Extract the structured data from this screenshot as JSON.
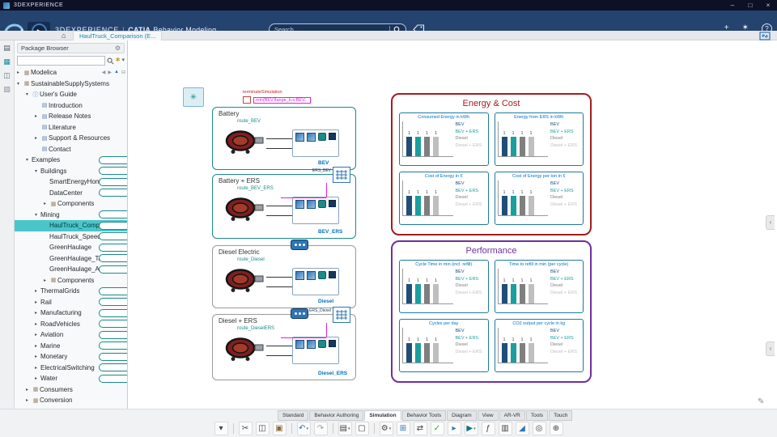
{
  "window": {
    "app_label": "3DEXPERIENCE",
    "minimize": "–",
    "maximize": "□",
    "close": "×"
  },
  "header": {
    "brand": "3DEXPERIENCE",
    "divider": "|",
    "app_bold": "CATIA",
    "app_name": "Behavior Modeling",
    "search_placeholder": "Search",
    "compass_text": "V.R",
    "right_icons": [
      {
        "name": "add-icon",
        "glyph": "+"
      },
      {
        "name": "tools-icon",
        "glyph": "✶"
      },
      {
        "name": "help-icon",
        "glyph": "?",
        "help": true
      }
    ]
  },
  "tabbar": {
    "home_glyph": "⌂",
    "tab_label": "HaulTruck_Comparison (E..."
  },
  "left_rail": [
    {
      "name": "content-panel-icon",
      "glyph": "▤",
      "color": "#4a5a68"
    },
    {
      "name": "search-panel-icon",
      "glyph": "▦",
      "color": "#1b8a9e"
    },
    {
      "name": "layers-panel-icon",
      "glyph": "◫",
      "color": "#6a7684"
    },
    {
      "name": "history-panel-icon",
      "glyph": "▧",
      "color": "#8a93a0"
    }
  ],
  "package_browser": {
    "title": "Package Browser",
    "gear_glyph": "⚙",
    "search_value": "",
    "nav_icons": [
      {
        "name": "back-icon",
        "glyph": "◀",
        "cls": ""
      },
      {
        "name": "forward-icon",
        "glyph": "▶",
        "cls": ""
      },
      {
        "name": "up-icon",
        "glyph": "▲",
        "cls": "up"
      },
      {
        "name": "collapse-all-icon",
        "glyph": "⊟",
        "cls": ""
      }
    ],
    "tree_icon_glyphs": {
      "package": "▦",
      "model": "▣",
      "info": "ⓘ",
      "doc": "▤"
    },
    "tree": [
      {
        "label": "Modelica",
        "level": 0,
        "icon": "package",
        "expander": "collapsed",
        "nav": true
      },
      {
        "label": "SustainableSupplySystems",
        "level": 0,
        "icon": "package",
        "expander": "expanded"
      },
      {
        "label": "User's Guide",
        "level": 1,
        "icon": "info",
        "expander": "expanded"
      },
      {
        "label": "Introduction",
        "level": 2,
        "icon": "doc"
      },
      {
        "label": "Release Notes",
        "level": 2,
        "icon": "doc",
        "expander": "collapsed"
      },
      {
        "label": "Literature",
        "level": 2,
        "icon": "doc"
      },
      {
        "label": "Support & Resources",
        "level": 2,
        "icon": "doc",
        "expander": "collapsed"
      },
      {
        "label": "Contact",
        "level": 2,
        "icon": "doc"
      },
      {
        "label": "Examples",
        "level": 1,
        "icon": "model",
        "expander": "expanded"
      },
      {
        "label": "Buildings",
        "level": 2,
        "icon": "model",
        "expander": "expanded"
      },
      {
        "label": "SmartEnergyHome",
        "level": 3,
        "icon": "model"
      },
      {
        "label": "DataCenter",
        "level": 3,
        "icon": "model"
      },
      {
        "label": "Components",
        "level": 3,
        "icon": "package",
        "expander": "collapsed"
      },
      {
        "label": "Mining",
        "level": 2,
        "icon": "model",
        "expander": "expanded"
      },
      {
        "label": "HaulTruck_Comparison",
        "level": 3,
        "icon": "model",
        "selected": true
      },
      {
        "label": "HaulTruck_SpeedERS",
        "level": 3,
        "icon": "model"
      },
      {
        "label": "GreenHaulage",
        "level": 3,
        "icon": "model"
      },
      {
        "label": "GreenHaulage_TableL...",
        "level": 3,
        "icon": "model"
      },
      {
        "label": "GreenHaulage_AvgdL...",
        "level": 3,
        "icon": "model"
      },
      {
        "label": "Components",
        "level": 3,
        "icon": "package",
        "expander": "collapsed"
      },
      {
        "label": "ThermalGrids",
        "level": 2,
        "icon": "model",
        "expander": "collapsed"
      },
      {
        "label": "Rail",
        "level": 2,
        "icon": "model",
        "expander": "collapsed"
      },
      {
        "label": "Manufacturing",
        "level": 2,
        "icon": "model",
        "expander": "collapsed"
      },
      {
        "label": "RoadVehicles",
        "level": 2,
        "icon": "model",
        "expander": "collapsed"
      },
      {
        "label": "Aviation",
        "level": 2,
        "icon": "model",
        "expander": "collapsed"
      },
      {
        "label": "Marine",
        "level": 2,
        "icon": "model",
        "expander": "collapsed"
      },
      {
        "label": "Monetary",
        "level": 2,
        "icon": "model",
        "expander": "collapsed"
      },
      {
        "label": "ElectricalSwitching",
        "level": 2,
        "icon": "model",
        "expander": "collapsed"
      },
      {
        "label": "Water",
        "level": 2,
        "icon": "model",
        "expander": "collapsed"
      },
      {
        "label": "Consumers",
        "level": 1,
        "icon": "package",
        "expander": "collapsed"
      },
      {
        "label": "Conversion",
        "level": 1,
        "icon": "package",
        "expander": "collapsed"
      }
    ]
  },
  "canvas": {
    "ambient": {
      "glyph": "✳"
    },
    "annotations": {
      "terminate_title": "terminateSimulation",
      "terminate_condition": "min(BEV.flange_b.s,BEV..."
    },
    "models": [
      {
        "title": "Battery",
        "route_label": "route_BEV",
        "result_label": "BEV",
        "accent": "#1b8a8a",
        "ers": false,
        "top_icon": false
      },
      {
        "title": "Battery + ERS",
        "route_label": "route_BEV_ERS",
        "result_label": "BEV_ERS",
        "accent": "#1b8a8a",
        "ers": true,
        "ers_label": "ERS_BEV",
        "top_icon": false
      },
      {
        "title": "Diesel Electric",
        "route_label": "route_Diesel",
        "result_label": "Diesel",
        "accent": "#9a9a9a",
        "ers": false,
        "top_icon": true
      },
      {
        "title": "Diesel + ERS",
        "route_label": "route_DieselERS",
        "result_label": "Diesel_ERS",
        "accent": "#9a9a9a",
        "ers": true,
        "ers_label": "ERS_Diesel",
        "top_icon": true
      }
    ],
    "groups": [
      {
        "title": "Energy & Cost",
        "color": "#a61c1c"
      },
      {
        "title": "Performance",
        "color": "#7030a0"
      }
    ]
  },
  "chart_data": [
    {
      "type": "bar",
      "group": "Energy & Cost",
      "title": "Consumed Energy in kWh",
      "categories": [
        "BEV",
        "BEV + ERS",
        "Diesel",
        "Diesel + ERS"
      ],
      "values": [
        1,
        1,
        1,
        1
      ],
      "bar_labels": [
        "1",
        "1",
        "1",
        "1"
      ],
      "colors": [
        "#1f4e79",
        "#1b9e9e",
        "#7f7f7f",
        "#bfbfbf"
      ],
      "legend_position": "right"
    },
    {
      "type": "bar",
      "group": "Energy & Cost",
      "title": "Energy from ERS in kWh",
      "categories": [
        "BEV",
        "BEV + ERS",
        "Diesel",
        "Diesel + ERS"
      ],
      "values": [
        1,
        1,
        1,
        1
      ],
      "bar_labels": [
        "1",
        "1",
        "1",
        "1"
      ],
      "colors": [
        "#1f4e79",
        "#1b9e9e",
        "#7f7f7f",
        "#bfbfbf"
      ],
      "legend_position": "right"
    },
    {
      "type": "bar",
      "group": "Energy & Cost",
      "title": "Cost of Energy in €",
      "categories": [
        "BEV",
        "BEV + ERS",
        "Diesel",
        "Diesel + ERS"
      ],
      "values": [
        1,
        1,
        1,
        1
      ],
      "bar_labels": [
        "1",
        "1",
        "1",
        "1"
      ],
      "colors": [
        "#1f4e79",
        "#1b9e9e",
        "#7f7f7f",
        "#bfbfbf"
      ],
      "legend_position": "right"
    },
    {
      "type": "bar",
      "group": "Energy & Cost",
      "title": "Cost of Energy per ton in €",
      "categories": [
        "BEV",
        "BEV + ERS",
        "Diesel",
        "Diesel + ERS"
      ],
      "values": [
        1,
        1,
        1,
        1
      ],
      "bar_labels": [
        "1",
        "1",
        "1",
        "1"
      ],
      "colors": [
        "#1f4e79",
        "#1b9e9e",
        "#7f7f7f",
        "#bfbfbf"
      ],
      "legend_position": "right"
    },
    {
      "type": "bar",
      "group": "Performance",
      "title": "Cycle Time in min (incl. refill)",
      "categories": [
        "BEV",
        "BEV + ERS",
        "Diesel",
        "Diesel + ERS"
      ],
      "values": [
        1,
        1,
        1,
        1
      ],
      "bar_labels": [
        "1",
        "1",
        "1",
        "1"
      ],
      "colors": [
        "#1f4e79",
        "#1b9e9e",
        "#7f7f7f",
        "#bfbfbf"
      ],
      "legend_position": "right"
    },
    {
      "type": "bar",
      "group": "Performance",
      "title": "Time to refill in min (per cycle)",
      "categories": [
        "BEV",
        "BEV + ERS",
        "Diesel",
        "Diesel + ERS"
      ],
      "values": [
        1,
        1,
        1,
        1
      ],
      "bar_labels": [
        "1",
        "1",
        "1",
        "1"
      ],
      "colors": [
        "#1f4e79",
        "#1b9e9e",
        "#7f7f7f",
        "#bfbfbf"
      ],
      "legend_position": "right"
    },
    {
      "type": "bar",
      "group": "Performance",
      "title": "Cycles per day",
      "categories": [
        "BEV",
        "BEV + ERS",
        "Diesel",
        "Diesel + ERS"
      ],
      "values": [
        1,
        1,
        1,
        1
      ],
      "bar_labels": [
        "1",
        "1",
        "1",
        "1"
      ],
      "colors": [
        "#1f4e79",
        "#1b9e9e",
        "#7f7f7f",
        "#bfbfbf"
      ],
      "legend_position": "right"
    },
    {
      "type": "bar",
      "group": "Performance",
      "title": "CO2 output per cycle in kg",
      "categories": [
        "BEV",
        "BEV + ERS",
        "Diesel",
        "Diesel + ERS"
      ],
      "values": [
        1,
        1,
        1,
        1
      ],
      "bar_labels": [
        "1",
        "1",
        "1",
        "1"
      ],
      "colors": [
        "#1f4e79",
        "#1b9e9e",
        "#7f7f7f",
        "#bfbfbf"
      ],
      "legend_position": "right"
    }
  ],
  "ribbon": {
    "tabs": [
      "Standard",
      "Behavior Authoring",
      "Simulation",
      "Behavior Tools",
      "Diagram",
      "View",
      "AR-VR",
      "Tools",
      "Touch"
    ],
    "active_tab": "Simulation"
  },
  "toolbar": [
    {
      "name": "toolbar-overflow-caret-icon",
      "glyph": "▾"
    },
    {
      "sep": true
    },
    {
      "name": "cut-icon",
      "glyph": "✂"
    },
    {
      "name": "copy-icon",
      "glyph": "◫"
    },
    {
      "name": "paste-icon",
      "glyph": "▣",
      "color": "#8a6d3b"
    },
    {
      "sep": true
    },
    {
      "name": "undo-icon",
      "glyph": "↶",
      "color": "#2e75b6",
      "caret": true
    },
    {
      "name": "redo-icon",
      "glyph": "↷",
      "color": "#9aa0a6"
    },
    {
      "sep": true
    },
    {
      "name": "new-document-icon",
      "glyph": "▤",
      "caret": true
    },
    {
      "name": "duplicate-icon",
      "glyph": "▢"
    },
    {
      "sep": true
    },
    {
      "name": "settings-icon",
      "glyph": "⚙",
      "caret": true
    },
    {
      "name": "insert-component-icon",
      "glyph": "⊞",
      "color": "#2e75b6"
    },
    {
      "name": "connect-icon",
      "glyph": "⇄"
    },
    {
      "name": "check-model-icon",
      "glyph": "✓",
      "color": "#2f9e44"
    },
    {
      "name": "translate-icon",
      "glyph": "▸",
      "color": "#2e75b6"
    },
    {
      "name": "simulate-icon",
      "glyph": "▶",
      "color": "#0b7285",
      "caret": true
    },
    {
      "name": "script-icon",
      "glyph": "ƒ"
    },
    {
      "name": "table-icon",
      "glyph": "▥"
    },
    {
      "name": "plot-icon",
      "glyph": "◢",
      "color": "#2e75b6"
    },
    {
      "name": "zoom-icon",
      "glyph": "◎"
    },
    {
      "name": "macro-icon",
      "glyph": "⊕"
    }
  ],
  "icons": {
    "pencil": "✎",
    "chevron": "‹"
  }
}
